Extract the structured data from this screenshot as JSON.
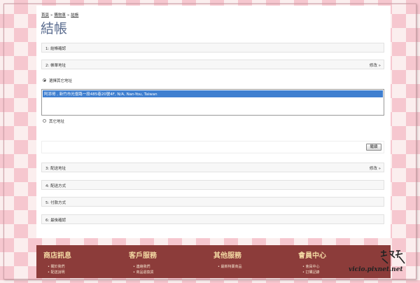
{
  "breadcrumb": [
    "首頁",
    "»",
    "購物車",
    "»",
    "結帳"
  ],
  "page_title": "結帳",
  "sections": {
    "s1": {
      "label": "1: 結帳確認"
    },
    "s2": {
      "label": "2: 帳單地址",
      "edit": "修改 »"
    },
    "s3": {
      "label": "3: 配送地址",
      "edit": "修改 »"
    },
    "s4": {
      "label": "4: 配送方式"
    },
    "s5": {
      "label": "5: 付款方式"
    },
    "s6": {
      "label": "6: 最後確認"
    }
  },
  "billing": {
    "select_existing_label": "選擇其它地址",
    "selected_address": "阿添哥 , 新竹市光復路一段485巷20號4F, N/A, Nan-You, Taiwan",
    "other_address_label": "其它地址",
    "continue_label": "繼續"
  },
  "footer": {
    "columns": [
      {
        "title": "商店訊息",
        "items": [
          "關於我們",
          "配送說明"
        ]
      },
      {
        "title": "客戶服務",
        "items": [
          "連絡我們",
          "商品退換貨"
        ]
      },
      {
        "title": "其他服務",
        "items": [
          "最新特賣商品"
        ]
      },
      {
        "title": "會員中心",
        "items": [
          "會員中心",
          "訂購記錄"
        ]
      }
    ]
  },
  "watermark": {
    "url": "vicio.pixnet.net"
  },
  "colors": {
    "title": "#5a6c8f",
    "footer_bg": "#8c3c3a",
    "selection": "#3f7fd0"
  }
}
